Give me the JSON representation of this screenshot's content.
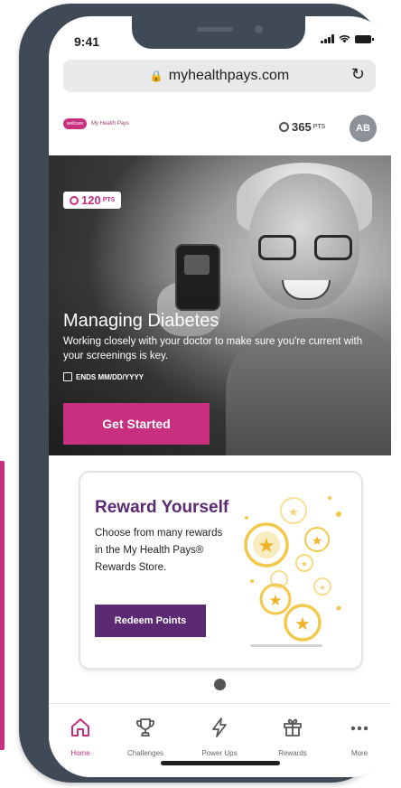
{
  "status_bar": {
    "time": "9:41"
  },
  "browser": {
    "url": "myhealthpays.com"
  },
  "header": {
    "logo_badge": "wellcare",
    "logo_text": "My Health Pays",
    "points": "365",
    "points_unit": "PTS",
    "avatar_initials": "AB"
  },
  "hero": {
    "points": "120",
    "points_unit": "PTS",
    "title": "Managing Diabetes",
    "subtitle": "Working closely with your doctor to make sure you're current with your screenings is key.",
    "ends": "ENDS MM/DD/YYYY",
    "cta": "Get Started"
  },
  "reward_card": {
    "title": "Reward Yourself",
    "body": "Choose from many rewards in the My Health Pays® Rewards Store.",
    "cta": "Redeem Points"
  },
  "tabbar": {
    "tabs": [
      {
        "label": "Home",
        "icon": "home-icon",
        "active": true
      },
      {
        "label": "Challenges",
        "icon": "trophy-icon",
        "active": false
      },
      {
        "label": "Power Ups",
        "icon": "lightning-icon",
        "active": false
      },
      {
        "label": "Rewards",
        "icon": "gift-icon",
        "active": false
      },
      {
        "label": "More",
        "icon": "more-icon",
        "active": false
      }
    ]
  },
  "colors": {
    "accent": "#c8307f",
    "purple": "#5b2a73",
    "frame": "#3f4a56"
  }
}
